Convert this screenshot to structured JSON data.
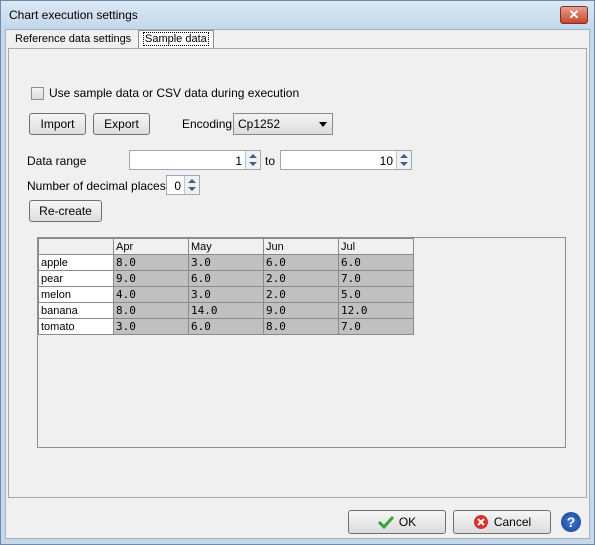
{
  "window": {
    "title": "Chart execution settings",
    "close_label": "✕"
  },
  "tabs": [
    {
      "label": "Reference data settings"
    },
    {
      "label": "Sample data"
    }
  ],
  "sample": {
    "checkbox_label": "Use sample data or CSV data during execution",
    "import_label": "Import",
    "export_label": "Export",
    "encoding_label": "Encoding",
    "encoding_value": "Cp1252",
    "data_range_label": "Data range",
    "range_from": "1",
    "range_to_label": "to",
    "range_to": "10",
    "decimal_label": "Number of decimal places",
    "decimal_value": "0",
    "recreate_label": "Re-create"
  },
  "table": {
    "columns": [
      "Apr",
      "May",
      "Jun",
      "Jul"
    ],
    "rows": [
      {
        "name": "apple",
        "values": [
          "8.0",
          "3.0",
          "6.0",
          "6.0"
        ]
      },
      {
        "name": "pear",
        "values": [
          "9.0",
          "6.0",
          "2.0",
          "7.0"
        ]
      },
      {
        "name": "melon",
        "values": [
          "4.0",
          "3.0",
          "2.0",
          "5.0"
        ]
      },
      {
        "name": "banana",
        "values": [
          "8.0",
          "14.0",
          "9.0",
          "12.0"
        ]
      },
      {
        "name": "tomato",
        "values": [
          "3.0",
          "6.0",
          "8.0",
          "7.0"
        ]
      }
    ]
  },
  "footer": {
    "ok_label": "OK",
    "cancel_label": "Cancel",
    "help_label": "?"
  }
}
